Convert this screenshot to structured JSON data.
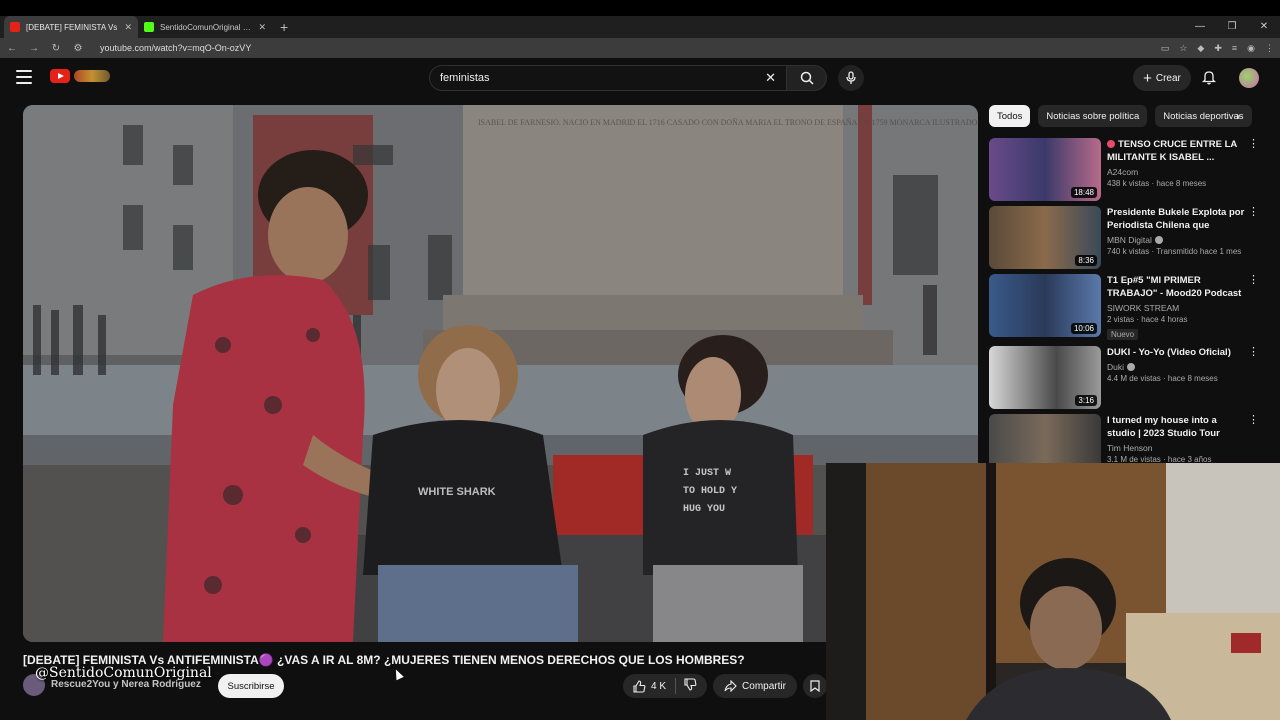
{
  "browser": {
    "tabs": [
      {
        "title": "[DEBATE] FEMINISTA Vs",
        "active": true,
        "fav_color": "#e62117"
      },
      {
        "title": "SentidoComunOriginal Stream",
        "active": false,
        "fav_color": "#53fc18"
      }
    ],
    "url": "youtube.com/watch?v=mqO-On-ozVY"
  },
  "header": {
    "search_query": "feministas",
    "create_label": "Crear"
  },
  "video": {
    "title": "[DEBATE] FEMINISTA Vs ANTIFEMINISTA🟣 ¿VAS A IR AL 8M? ¿MUJERES TIENEN MENOS DERECHOS QUE LOS HOMBRES?",
    "channel": "Rescue2You y Nerea Rodríguez",
    "watermark": "@SentidoComunOriginal",
    "subscribe_label": "Suscribirse",
    "likes": "4 K",
    "share_label": "Compartir",
    "plaque_text": "ISABEL DE FARNESIO. NACIO EN MADRID EL 1716 CASADO CON DOÑA MARIA EL TRONO DE ESPAÑA EN 1759 MONARCA ILUSTRADO GOBERNO V",
    "shirt_text": "I JUST W TO HOLD Y HUG YOU"
  },
  "chips": [
    "Todos",
    "Noticias sobre política",
    "Noticias deportivas"
  ],
  "recommendations": [
    {
      "title": "TENSO CRUCE ENTRE LA MILITANTE K ISABEL ...",
      "live_dot": true,
      "channel": "A24com",
      "verified": false,
      "meta": "438 k vistas · hace 8 meses",
      "duration": "18:48",
      "badge": ""
    },
    {
      "title": "Presidente Bukele Explota por Periodista Chilena que Pregun...",
      "live_dot": false,
      "channel": "MBN Digital",
      "verified": true,
      "meta": "740 k vistas · Transmitido hace 1 mes",
      "duration": "8:36",
      "badge": ""
    },
    {
      "title": "T1 Ep#5 \"MI PRIMER TRABAJO\" - Mood20 Podcast",
      "live_dot": false,
      "channel": "SIWORK STREAM",
      "verified": false,
      "meta": "2 vistas · hace 4 horas",
      "duration": "10:06",
      "badge": "Nuevo"
    },
    {
      "title": "DUKI - Yo-Yo (Video Oficial)",
      "live_dot": false,
      "channel": "Duki",
      "verified": true,
      "meta": "4.4 M de vistas · hace 8 meses",
      "duration": "3:16",
      "badge": ""
    },
    {
      "title": "I turned my house into a studio | 2023 Studio Tour",
      "live_dot": false,
      "channel": "Tim Henson",
      "verified": false,
      "meta": "3.1 M de vistas · hace 3 años",
      "duration": "",
      "badge": ""
    }
  ]
}
